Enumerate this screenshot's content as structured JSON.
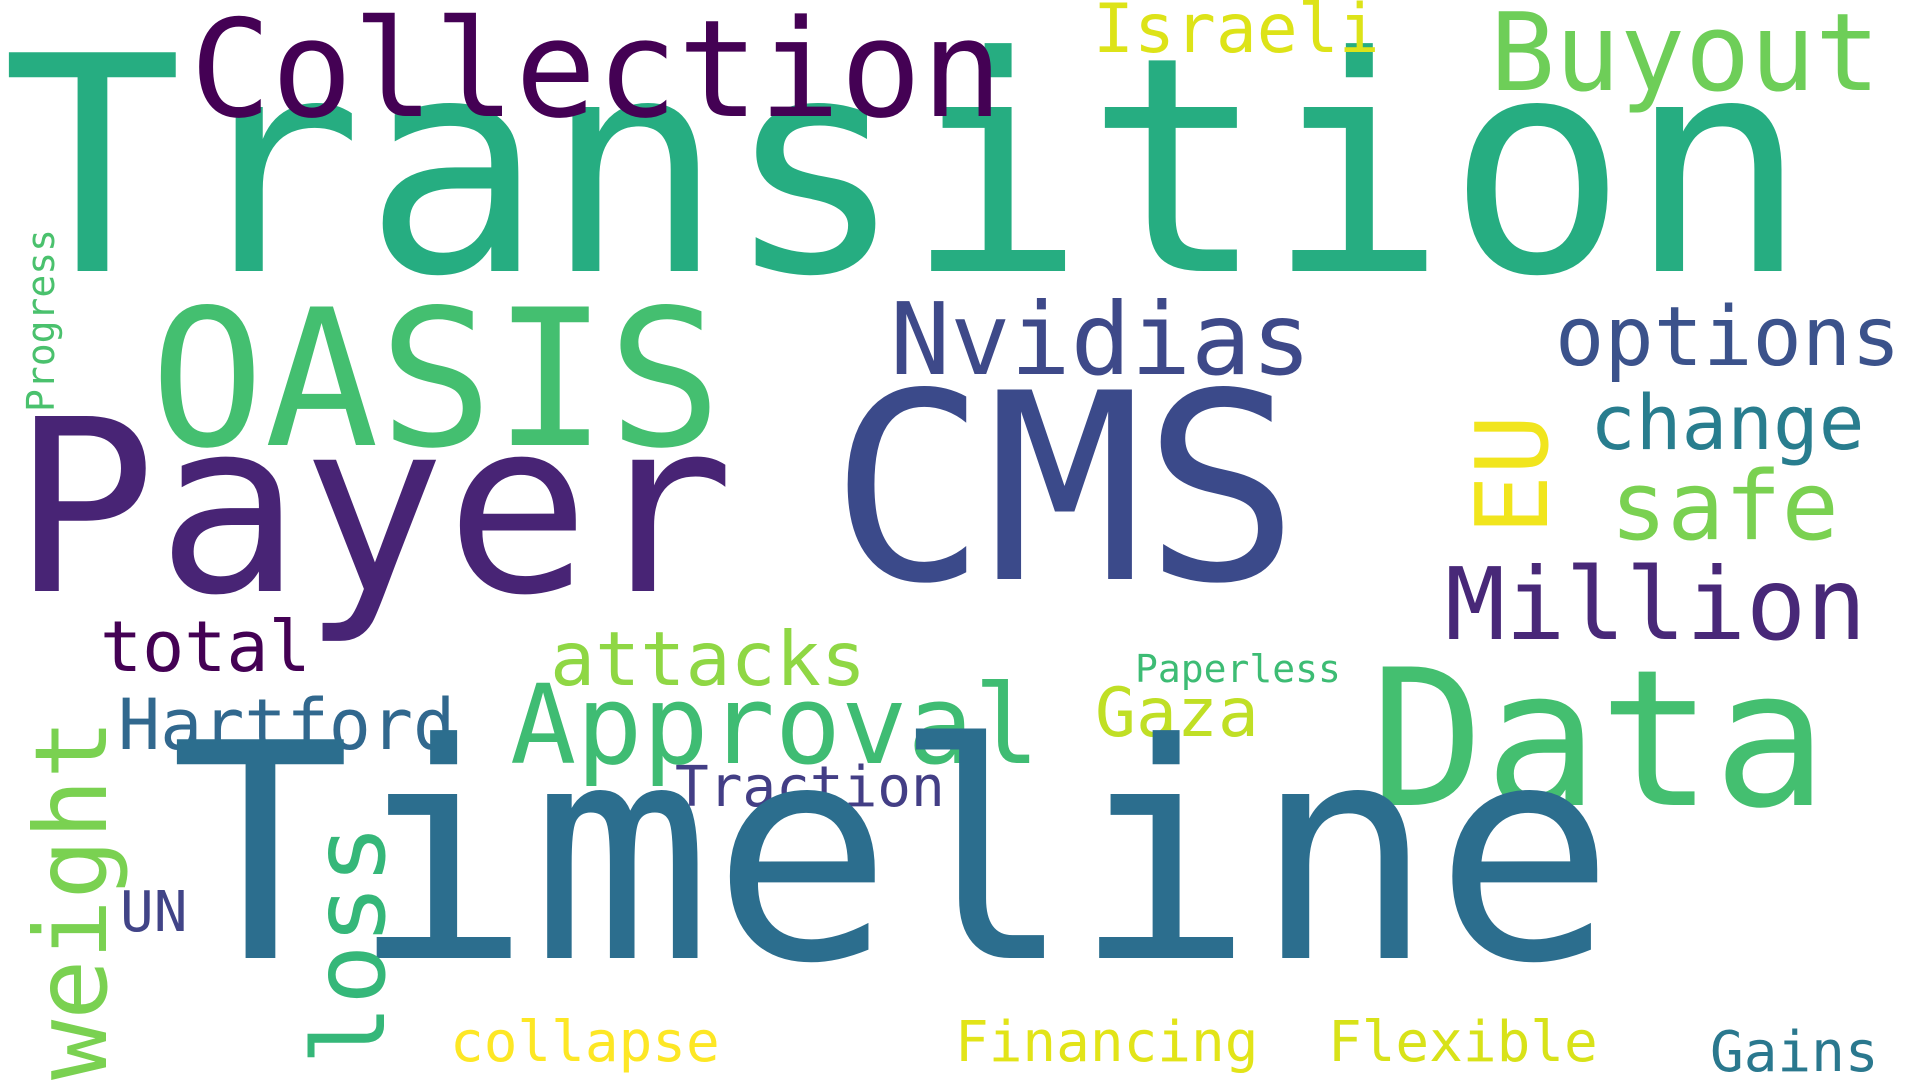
{
  "cloud": {
    "background": "#ffffff",
    "words": {
      "transition": {
        "text": "Transition",
        "color": "#26ad81"
      },
      "timeline": {
        "text": "Timeline",
        "color": "#2c6e8e"
      },
      "cms": {
        "text": "CMS",
        "color": "#3b4a8a"
      },
      "payer": {
        "text": "Payer",
        "color": "#482475"
      },
      "oasis": {
        "text": "OASIS",
        "color": "#44bf70"
      },
      "data": {
        "text": "Data",
        "color": "#44bf70"
      },
      "collection": {
        "text": "Collection",
        "color": "#440154"
      },
      "approval": {
        "text": "Approval",
        "color": "#3fbc73"
      },
      "buyout": {
        "text": "Buyout",
        "color": "#6ece58"
      },
      "nvidias": {
        "text": "Nvidias",
        "color": "#3e4989"
      },
      "million": {
        "text": "Million",
        "color": "#482878"
      },
      "safe": {
        "text": "safe",
        "color": "#7ad151"
      },
      "options": {
        "text": "options",
        "color": "#3b528b"
      },
      "change": {
        "text": "change",
        "color": "#287d8e"
      },
      "attacks": {
        "text": "attacks",
        "color": "#8fd744"
      },
      "hartford": {
        "text": "Hartford",
        "color": "#31688e"
      },
      "total": {
        "text": "total",
        "color": "#440154"
      },
      "gaza": {
        "text": "Gaza",
        "color": "#c0df25"
      },
      "israeli": {
        "text": "Israeli",
        "color": "#dde318"
      },
      "traction": {
        "text": "Traction",
        "color": "#433e85"
      },
      "collapse": {
        "text": "collapse",
        "color": "#fde725"
      },
      "financing": {
        "text": "Financing",
        "color": "#e2e418"
      },
      "flexible": {
        "text": "Flexible",
        "color": "#d8e219"
      },
      "gains": {
        "text": "Gains",
        "color": "#2a788e"
      },
      "un": {
        "text": "UN",
        "color": "#414487"
      },
      "paperless": {
        "text": "Paperless",
        "color": "#3dbc74"
      },
      "eu": {
        "text": "EU",
        "color": "#f1e51d"
      },
      "weight": {
        "text": "weight",
        "color": "#7ad151"
      },
      "loss": {
        "text": "loss",
        "color": "#35b779"
      },
      "progress": {
        "text": "Progress",
        "color": "#4ac16d"
      }
    }
  }
}
